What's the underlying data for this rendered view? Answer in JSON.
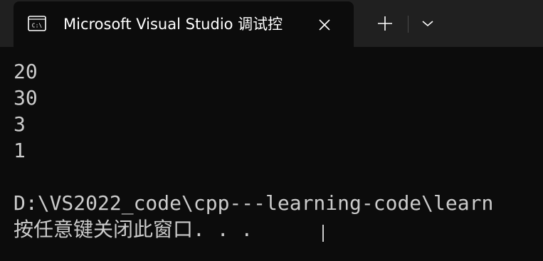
{
  "window": {
    "tab_title": "Microsoft Visual Studio 调试控",
    "icon": "console-icon"
  },
  "console": {
    "lines": [
      "20",
      "30",
      "3",
      "1",
      "",
      "D:\\VS2022_code\\cpp---learning-code\\learn",
      "按任意键关闭此窗口. . ."
    ]
  },
  "colors": {
    "titlebar": "#202020",
    "background": "#0c0c0c",
    "text": "#cccccc",
    "title_text": "#ffffff"
  }
}
